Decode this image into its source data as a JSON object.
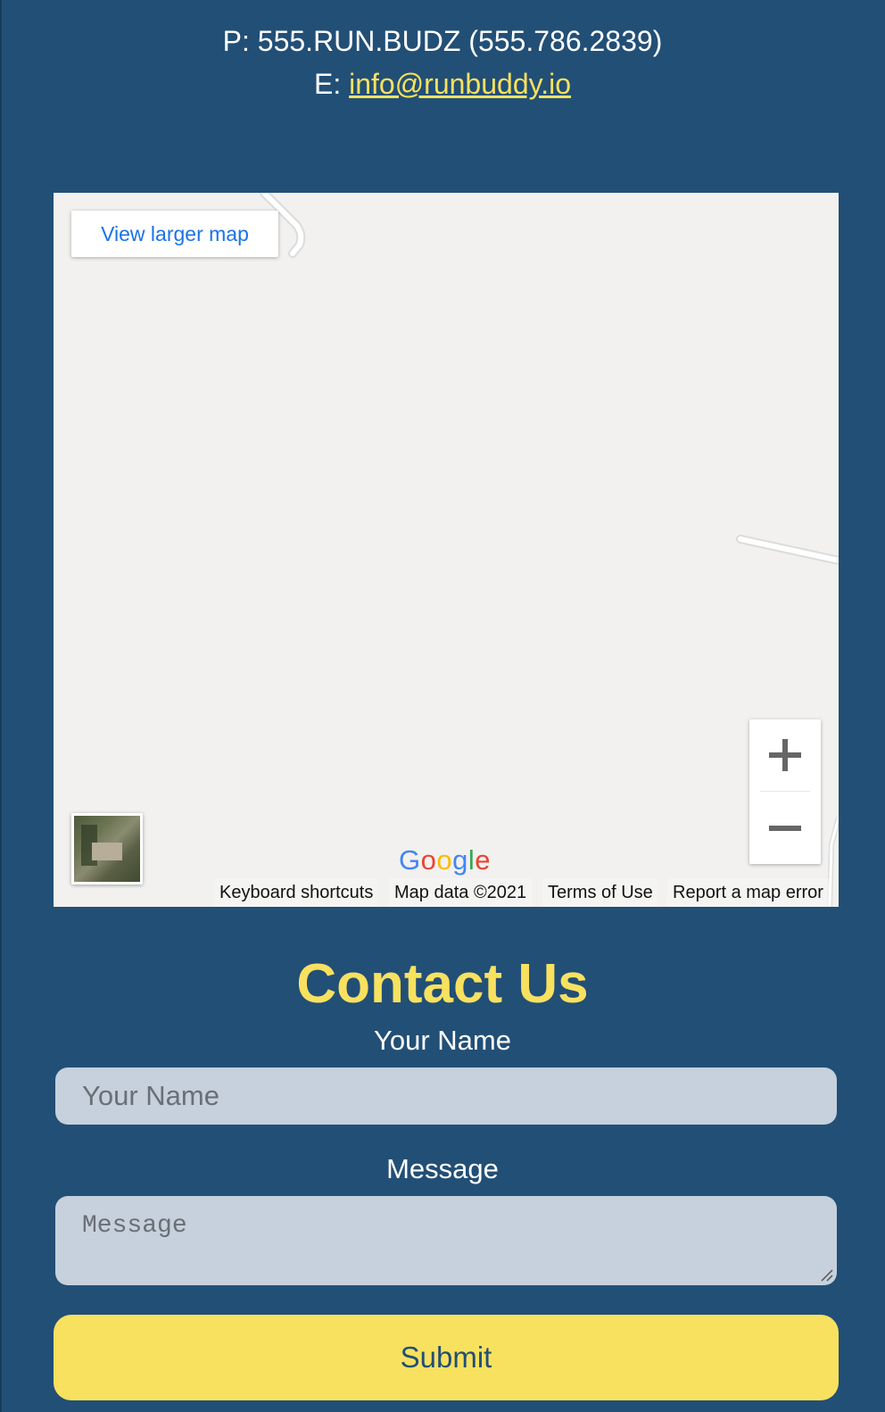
{
  "contact": {
    "phone_line": "P: 555.RUN.BUDZ (555.786.2839)",
    "email_prefix": "E: ",
    "email": "info@runbuddy.io"
  },
  "map": {
    "view_larger_label": "View larger map",
    "zoom_in_label": "+",
    "zoom_out_label": "−",
    "logo_text": "Google",
    "attribution": {
      "keyboard_shortcuts": "Keyboard shortcuts",
      "map_data": "Map data ©2021",
      "terms": "Terms of Use",
      "report": "Report a map error"
    }
  },
  "form": {
    "title": "Contact Us",
    "name_label": "Your Name",
    "name_placeholder": "Your Name",
    "message_label": "Message",
    "message_placeholder": "Message",
    "submit_label": "Submit"
  },
  "colors": {
    "background": "#224f76",
    "accent": "#f8e15f",
    "input_bg": "#c6d1dd"
  }
}
